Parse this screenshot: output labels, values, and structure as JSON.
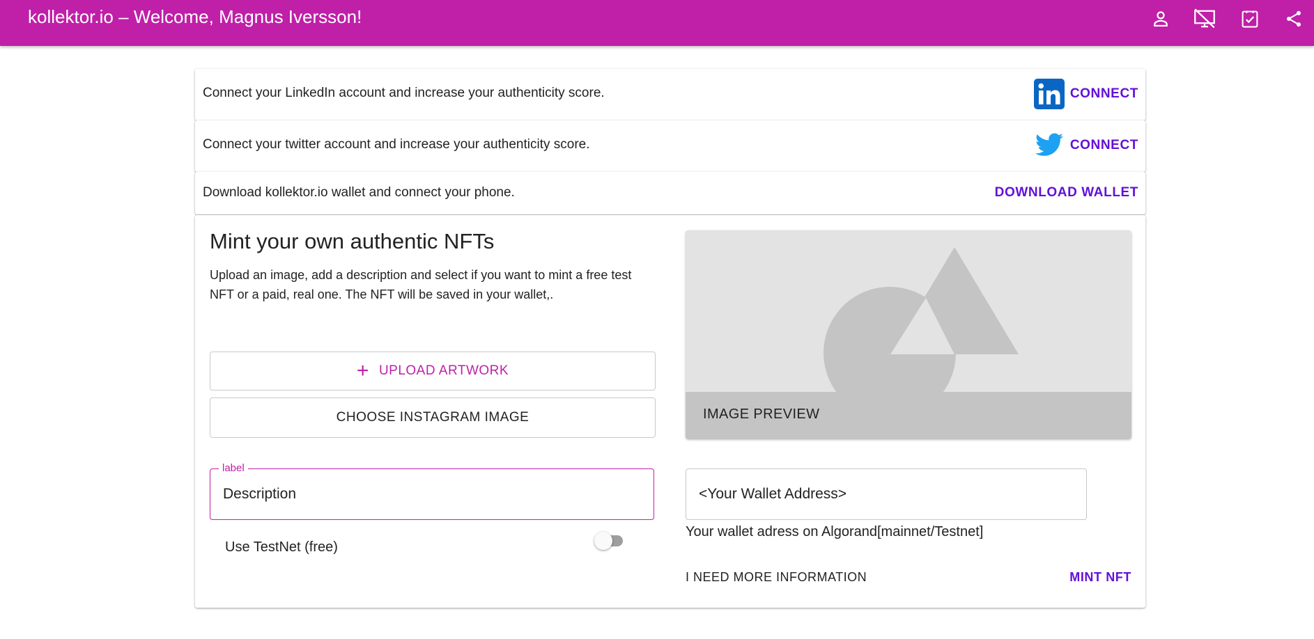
{
  "appbar": {
    "title": "kollektor.io – Welcome, Magnus Iversson!",
    "icons": [
      "person-icon",
      "desktop-off-icon",
      "checkbox-icon",
      "share-icon"
    ]
  },
  "connect_rows": [
    {
      "text": "Connect your LinkedIn account and increase your authenticity score.",
      "action": "CONNECT",
      "icon": "linkedin-icon"
    },
    {
      "text": "Connect your twitter account and increase your authenticity score.",
      "action": "CONNECT",
      "icon": "twitter-icon"
    },
    {
      "text": "Download kollektor.io wallet and connect your phone.",
      "action": "DOWNLOAD WALLET"
    }
  ],
  "mint": {
    "title": "Mint your own authentic NFTs",
    "description": "Upload an image, add a description and select if you want to mint a free test NFT or a paid, real one. The NFT will be saved in your wallet,.",
    "upload_label": "UPLOAD ARTWORK",
    "instagram_label": "CHOOSE INSTAGRAM IMAGE",
    "preview_label": "IMAGE PREVIEW",
    "description_field": {
      "label": "label",
      "value": "Description"
    },
    "wallet_field": {
      "value": "<Your Wallet Address>",
      "helper": "Your wallet adress on Algorand[mainnet/Testnet]"
    },
    "testnet_label": "Use TestNet (free)",
    "testnet_on": false,
    "more_info_label": "I NEED MORE INFORMATION",
    "mint_label": "MINT NFT"
  },
  "colors": {
    "primary": "#c01fa8",
    "accent": "#6210d8",
    "linkedin": "#0a66c2",
    "twitter": "#1da1f2"
  }
}
